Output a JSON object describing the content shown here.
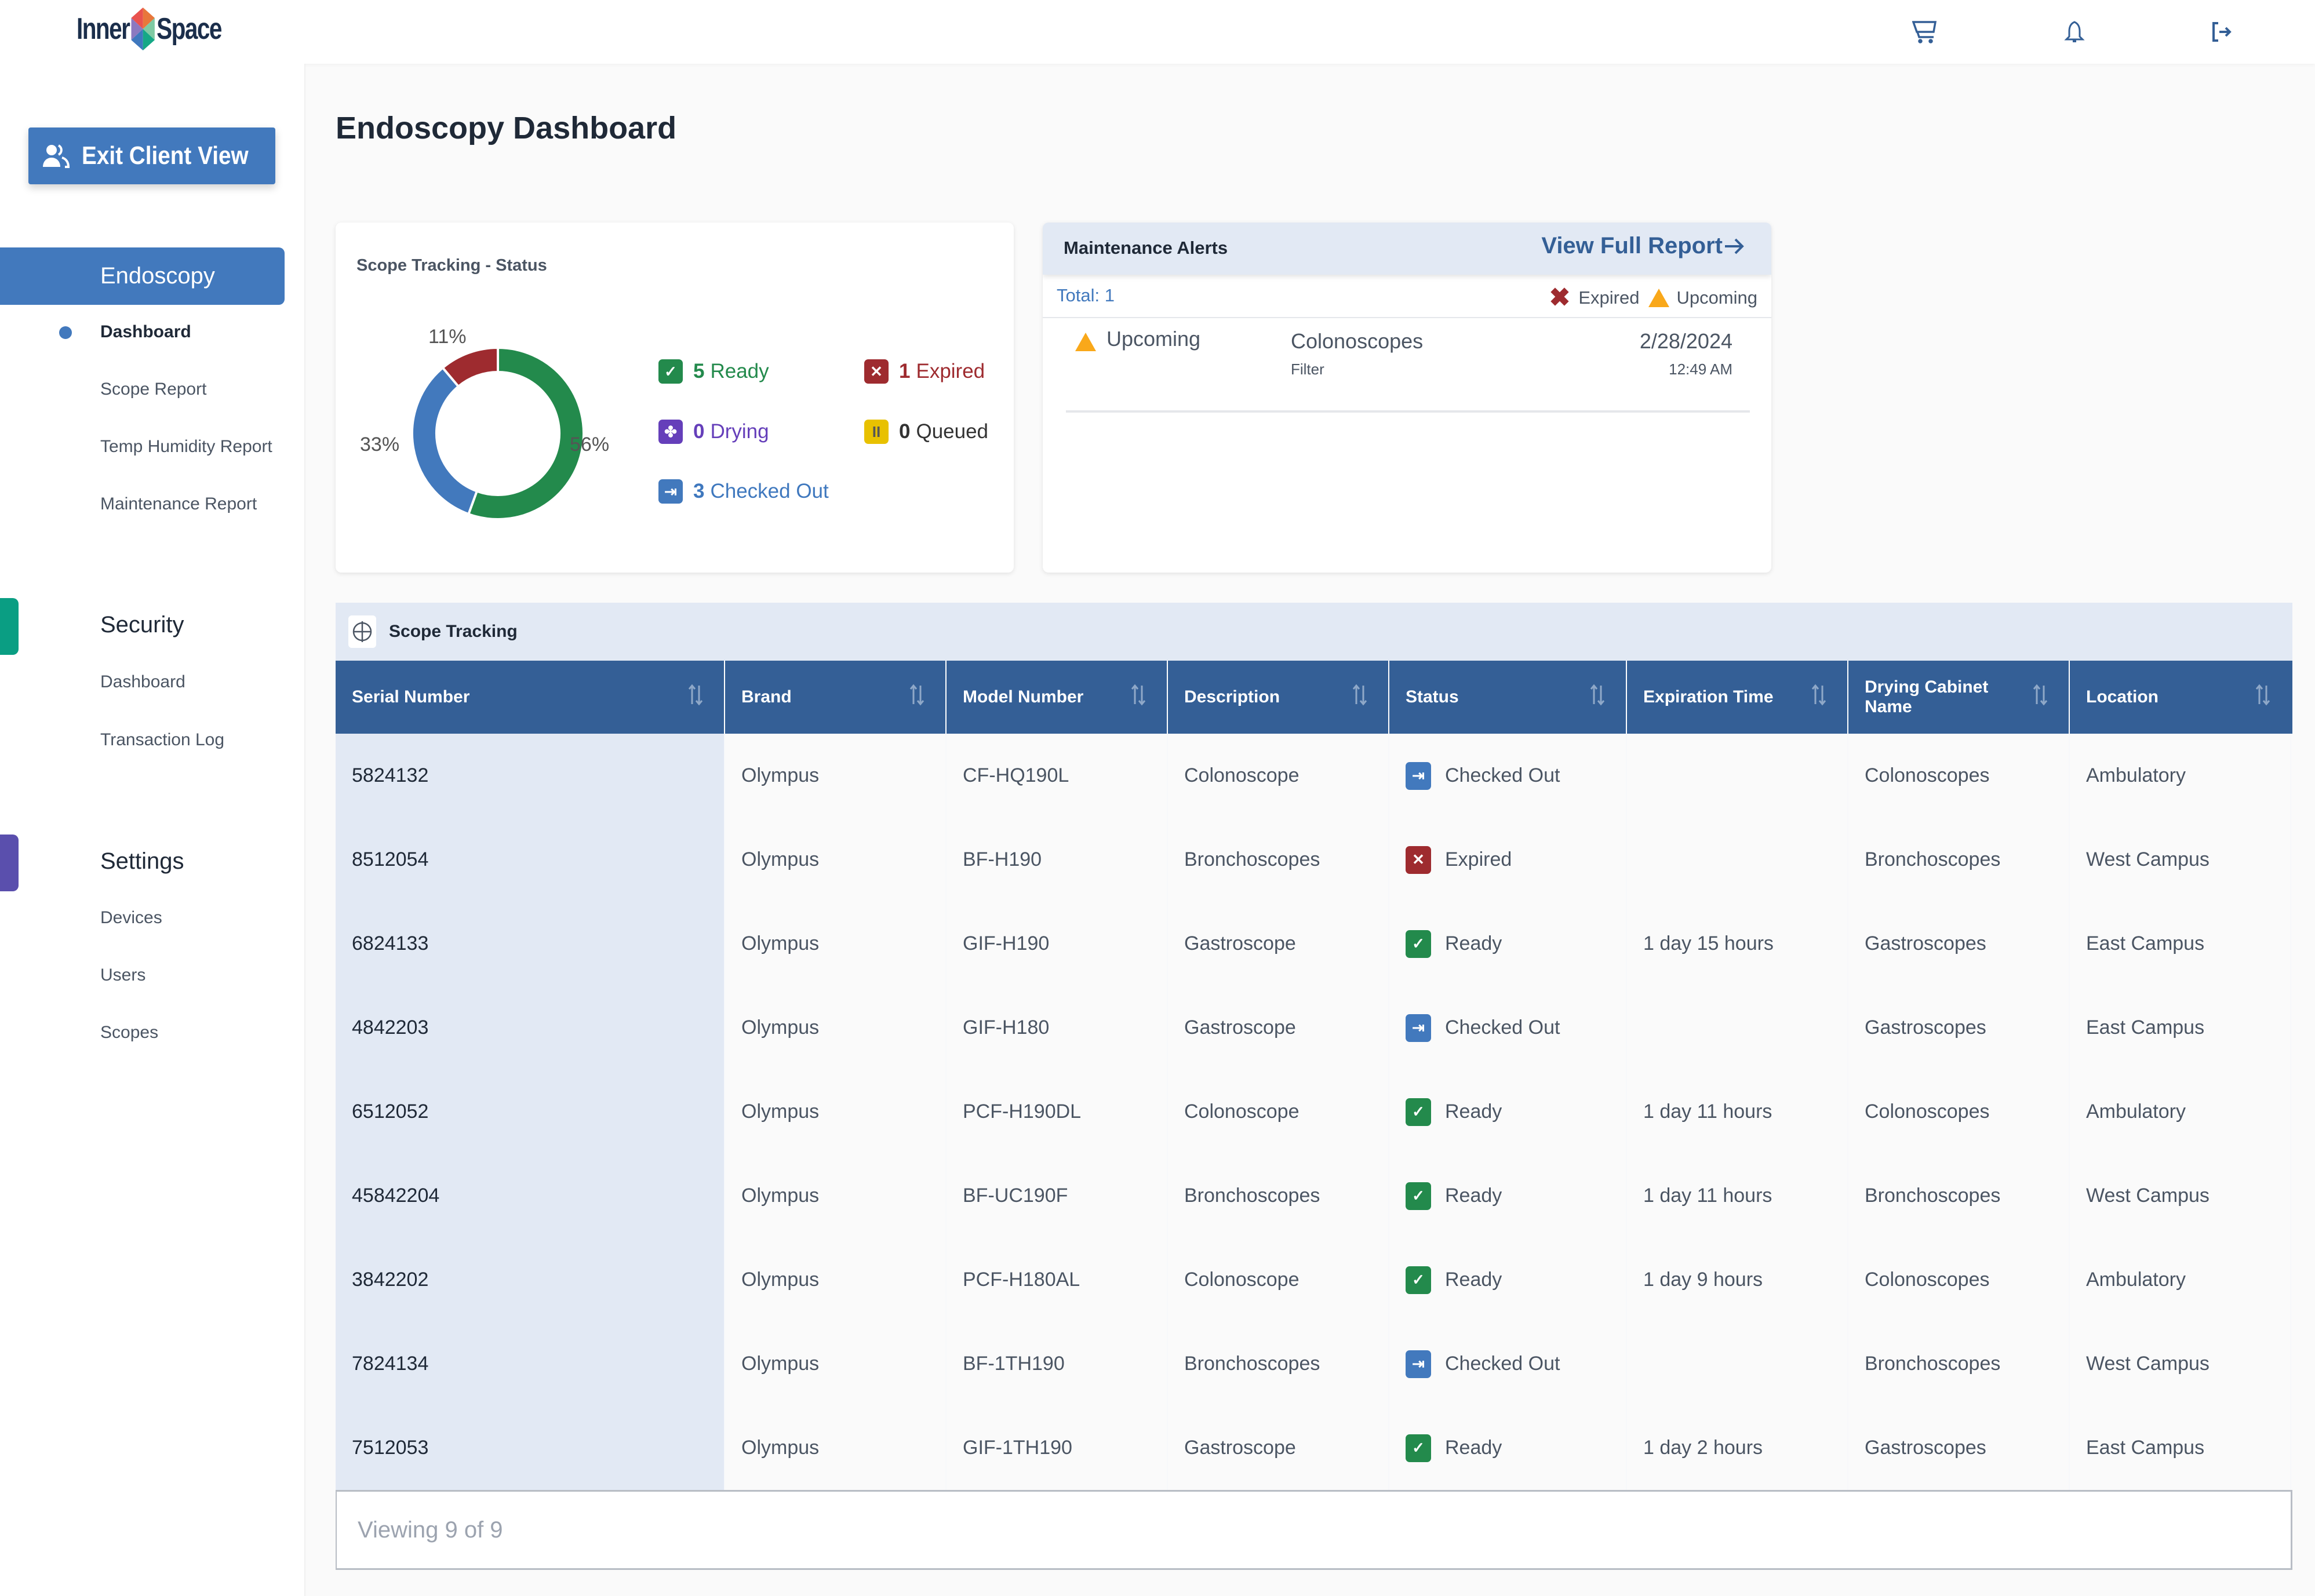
{
  "header": {
    "logo_left": "Inner",
    "logo_right": "Space",
    "icons": [
      "cart-icon",
      "bell-icon",
      "logout-icon"
    ]
  },
  "sidebar": {
    "exit_button": "Exit Client View",
    "sections": [
      {
        "label": "Endoscopy",
        "active": true,
        "items": [
          {
            "label": "Dashboard",
            "active": true
          },
          {
            "label": "Scope Report"
          },
          {
            "label": "Temp Humidity Report"
          },
          {
            "label": "Maintenance Report"
          }
        ]
      },
      {
        "label": "Security",
        "color": "#0a9e83",
        "items": [
          {
            "label": "Dashboard"
          },
          {
            "label": "Transaction Log"
          }
        ]
      },
      {
        "label": "Settings",
        "color": "#5a4fad",
        "items": [
          {
            "label": "Devices"
          },
          {
            "label": "Users"
          },
          {
            "label": "Scopes"
          }
        ]
      }
    ]
  },
  "page": {
    "title": "Endoscopy Dashboard"
  },
  "status_card": {
    "title": "Scope Tracking - Status",
    "legend": [
      {
        "count": "5",
        "label": "Ready",
        "color": "#238a4c",
        "icon": "check-icon"
      },
      {
        "count": "1",
        "label": "Expired",
        "color": "#9e2b2f",
        "icon": "x-icon"
      },
      {
        "count": "0",
        "label": "Drying",
        "color": "#653fba",
        "icon": "fan-icon"
      },
      {
        "count": "0",
        "label": "Queued",
        "color": "#333333",
        "badge_color": "#e8c100",
        "icon": "pause-icon"
      },
      {
        "count": "3",
        "label": "Checked Out",
        "color": "#3f78be",
        "icon": "checkout-icon"
      }
    ]
  },
  "chart_data": {
    "type": "pie",
    "title": "Scope Tracking - Status",
    "donut": true,
    "slices": [
      {
        "name": "Ready",
        "value": 5,
        "percent_label": "56%",
        "color": "#238a4c"
      },
      {
        "name": "Checked Out",
        "value": 3,
        "percent_label": "33%",
        "color": "#4279bd"
      },
      {
        "name": "Expired",
        "value": 1,
        "percent_label": "11%",
        "color": "#9e2b2f"
      }
    ]
  },
  "maintenance": {
    "title": "Maintenance Alerts",
    "view_full_report": "View Full Report",
    "total": "Total: 1",
    "legend_expired": "Expired",
    "legend_upcoming": "Upcoming",
    "alerts": [
      {
        "status": "Upcoming",
        "name": "Colonoscopes",
        "sub": "Filter",
        "date": "2/28/2024",
        "time": "12:49 AM"
      }
    ]
  },
  "tracking": {
    "title": "Scope Tracking",
    "columns": [
      "Serial Number",
      "Brand",
      "Model Number",
      "Description",
      "Status",
      "Expiration Time",
      "Drying Cabinet Name",
      "Location"
    ],
    "rows": [
      {
        "serial": "5824132",
        "brand": "Olympus",
        "model": "CF-HQ190L",
        "description": "Colonoscope",
        "status": "Checked Out",
        "expiration": "",
        "cabinet": "Colonoscopes",
        "location": "Ambulatory"
      },
      {
        "serial": "8512054",
        "brand": "Olympus",
        "model": "BF-H190",
        "description": "Bronchoscopes",
        "status": "Expired",
        "expiration": "",
        "cabinet": "Bronchoscopes",
        "location": "West Campus"
      },
      {
        "serial": "6824133",
        "brand": "Olympus",
        "model": "GIF-H190",
        "description": "Gastroscope",
        "status": "Ready",
        "expiration": "1 day 15 hours",
        "cabinet": "Gastroscopes",
        "location": "East Campus"
      },
      {
        "serial": "4842203",
        "brand": "Olympus",
        "model": "GIF-H180",
        "description": "Gastroscope",
        "status": "Checked Out",
        "expiration": "",
        "cabinet": "Gastroscopes",
        "location": "East Campus"
      },
      {
        "serial": "6512052",
        "brand": "Olympus",
        "model": "PCF-H190DL",
        "description": "Colonoscope",
        "status": "Ready",
        "expiration": "1 day 11 hours",
        "cabinet": "Colonoscopes",
        "location": "Ambulatory"
      },
      {
        "serial": "45842204",
        "brand": "Olympus",
        "model": "BF-UC190F",
        "description": "Bronchoscopes",
        "status": "Ready",
        "expiration": "1 day 11 hours",
        "cabinet": "Bronchoscopes",
        "location": "West Campus"
      },
      {
        "serial": "3842202",
        "brand": "Olympus",
        "model": "PCF-H180AL",
        "description": "Colonoscope",
        "status": "Ready",
        "expiration": "1 day 9 hours",
        "cabinet": "Colonoscopes",
        "location": "Ambulatory"
      },
      {
        "serial": "7824134",
        "brand": "Olympus",
        "model": "BF-1TH190",
        "description": "Bronchoscopes",
        "status": "Checked Out",
        "expiration": "",
        "cabinet": "Bronchoscopes",
        "location": "West Campus"
      },
      {
        "serial": "7512053",
        "brand": "Olympus",
        "model": "GIF-1TH190",
        "description": "Gastroscope",
        "status": "Ready",
        "expiration": "1 day 2 hours",
        "cabinet": "Gastroscopes",
        "location": "East Campus"
      }
    ],
    "footer": "Viewing 9 of 9"
  },
  "status_colors": {
    "Ready": "#238a4c",
    "Expired": "#9e2b2f",
    "Checked Out": "#4279bd"
  }
}
